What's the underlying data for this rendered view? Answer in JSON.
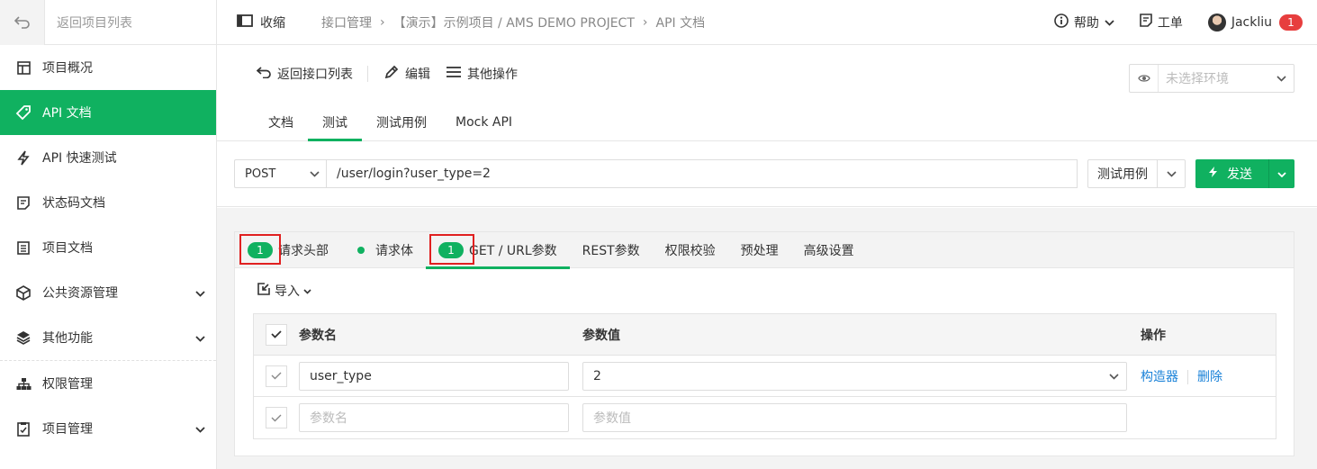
{
  "sidebar": {
    "back_label": "返回项目列表",
    "items": [
      {
        "label": "项目概况",
        "icon": "grid-icon"
      },
      {
        "label": "API 文档",
        "icon": "tag-icon",
        "active": true
      },
      {
        "label": "API 快速测试",
        "icon": "lightning-icon"
      },
      {
        "label": "状态码文档",
        "icon": "note-icon"
      },
      {
        "label": "项目文档",
        "icon": "document-icon"
      },
      {
        "label": "公共资源管理",
        "icon": "cube-icon",
        "expandable": true
      },
      {
        "label": "其他功能",
        "icon": "layers-icon",
        "expandable": true
      },
      {
        "label": "权限管理",
        "icon": "sitemap-icon"
      },
      {
        "label": "项目管理",
        "icon": "clipboard-icon",
        "expandable": true
      }
    ]
  },
  "topbar": {
    "collapse_label": "收缩",
    "breadcrumbs": [
      "接口管理",
      "【演示】示例项目 / AMS DEMO PROJECT",
      "API 文档"
    ],
    "help_label": "帮助",
    "ticket_label": "工单",
    "user_name": "Jackliu",
    "notification_count": "1"
  },
  "toolbar": {
    "back_label": "返回接口列表",
    "edit_label": "编辑",
    "more_label": "其他操作",
    "env_placeholder": "未选择环境",
    "tabs": [
      "文档",
      "测试",
      "测试用例",
      "Mock API"
    ],
    "active_tab": "测试"
  },
  "request": {
    "method": "POST",
    "url": "/user/login?user_type=2",
    "case_label": "测试用例",
    "send_label": "发送"
  },
  "panel": {
    "tabs": [
      {
        "label": "请求头部",
        "count": "1"
      },
      {
        "label": "请求体",
        "dot": true
      },
      {
        "label": "GET / URL参数",
        "count": "1",
        "active": true
      },
      {
        "label": "REST参数"
      },
      {
        "label": "权限校验"
      },
      {
        "label": "预处理"
      },
      {
        "label": "高级设置"
      }
    ],
    "import_label": "导入",
    "columns": {
      "name": "参数名",
      "value": "参数值",
      "op": "操作"
    },
    "rows": [
      {
        "name": "user_type",
        "value": "2",
        "ops": [
          "构造器",
          "删除"
        ]
      }
    ],
    "new_row": {
      "name_placeholder": "参数名",
      "value_placeholder": "参数值"
    }
  },
  "colors": {
    "accent": "#10b160",
    "link": "#1a82d8",
    "badge": "#e73e3e",
    "highlight": "#e02020"
  }
}
